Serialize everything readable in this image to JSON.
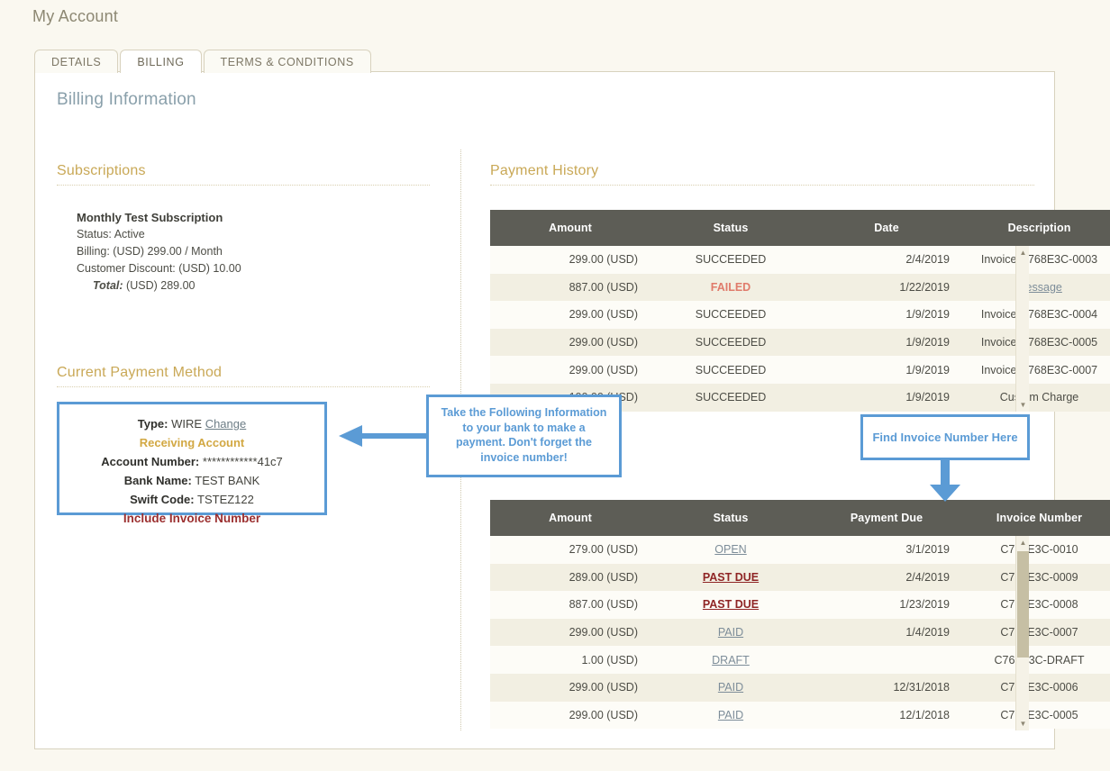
{
  "page": {
    "title": "My Account"
  },
  "tabs": [
    {
      "label": "DETAILS",
      "active": false
    },
    {
      "label": "BILLING",
      "active": true
    },
    {
      "label": "TERMS & CONDITIONS",
      "active": false
    }
  ],
  "billing": {
    "heading": "Billing Information"
  },
  "subscriptions": {
    "heading": "Subscriptions",
    "name": "Monthly Test Subscription",
    "status": "Status: Active",
    "billing": "Billing: (USD) 299.00 / Month",
    "discount": "Customer Discount: (USD) 10.00",
    "total_label": "Total:",
    "total_value": "(USD) 289.00"
  },
  "payment_method": {
    "heading": "Current Payment Method",
    "type_label": "Type:",
    "type_value": "WIRE",
    "change_link": "Change",
    "receiving_account": "Receiving Account",
    "account_number_label": "Account Number:",
    "account_number_value": "************41c7",
    "bank_name_label": "Bank Name:",
    "bank_name_value": "TEST BANK",
    "swift_label": "Swift Code:",
    "swift_value": "TSTEZ122",
    "note": "Include Invoice Number"
  },
  "payment_history": {
    "heading": "Payment History",
    "columns": [
      "Amount",
      "Status",
      "Date",
      "Description"
    ],
    "rows": [
      {
        "amount": "299.00 (USD)",
        "status": "SUCCEEDED",
        "status_style": "plain",
        "date": "2/4/2019",
        "description": "Invoice C768E3C-0003",
        "desc_style": "plain"
      },
      {
        "amount": "887.00 (USD)",
        "status": "FAILED",
        "status_style": "failed",
        "date": "1/22/2019",
        "description": "Message",
        "desc_style": "link"
      },
      {
        "amount": "299.00 (USD)",
        "status": "SUCCEEDED",
        "status_style": "plain",
        "date": "1/9/2019",
        "description": "Invoice C768E3C-0004",
        "desc_style": "plain"
      },
      {
        "amount": "299.00 (USD)",
        "status": "SUCCEEDED",
        "status_style": "plain",
        "date": "1/9/2019",
        "description": "Invoice C768E3C-0005",
        "desc_style": "plain"
      },
      {
        "amount": "299.00 (USD)",
        "status": "SUCCEEDED",
        "status_style": "plain",
        "date": "1/9/2019",
        "description": "Invoice C768E3C-0007",
        "desc_style": "plain"
      },
      {
        "amount": "100.00 (USD)",
        "status": "SUCCEEDED",
        "status_style": "plain",
        "date": "1/9/2019",
        "description": "Custom Charge",
        "desc_style": "plain"
      }
    ]
  },
  "invoices": {
    "columns": [
      "Amount",
      "Status",
      "Payment Due",
      "Invoice Number"
    ],
    "rows": [
      {
        "amount": "279.00 (USD)",
        "status": "OPEN",
        "status_style": "link",
        "due": "3/1/2019",
        "invoice": "C768E3C-0010"
      },
      {
        "amount": "289.00 (USD)",
        "status": "PAST DUE",
        "status_style": "pastdue",
        "due": "2/4/2019",
        "invoice": "C768E3C-0009"
      },
      {
        "amount": "887.00 (USD)",
        "status": "PAST DUE",
        "status_style": "pastdue",
        "due": "1/23/2019",
        "invoice": "C768E3C-0008"
      },
      {
        "amount": "299.00 (USD)",
        "status": "PAID",
        "status_style": "link",
        "due": "1/4/2019",
        "invoice": "C768E3C-0007"
      },
      {
        "amount": "1.00 (USD)",
        "status": "DRAFT",
        "status_style": "link",
        "due": "",
        "invoice": "C768E3C-DRAFT"
      },
      {
        "amount": "299.00 (USD)",
        "status": "PAID",
        "status_style": "link",
        "due": "12/31/2018",
        "invoice": "C768E3C-0006"
      },
      {
        "amount": "299.00 (USD)",
        "status": "PAID",
        "status_style": "link",
        "due": "12/1/2018",
        "invoice": "C768E3C-0005"
      }
    ]
  },
  "callouts": {
    "bank": "Take the Following Information to your bank to make a payment. Don't forget the invoice number!",
    "invoice": "Find Invoice Number Here"
  },
  "colors": {
    "accent_blue": "#5b9bd5",
    "header_gray": "#5d5d56",
    "gold": "#c9a856",
    "steel": "#8aa0ab",
    "danger": "#8f2525",
    "failed": "#e07b6b",
    "page_bg": "#faf8f0"
  },
  "icons": {
    "scroll_up": "▲",
    "scroll_down": "▼"
  }
}
